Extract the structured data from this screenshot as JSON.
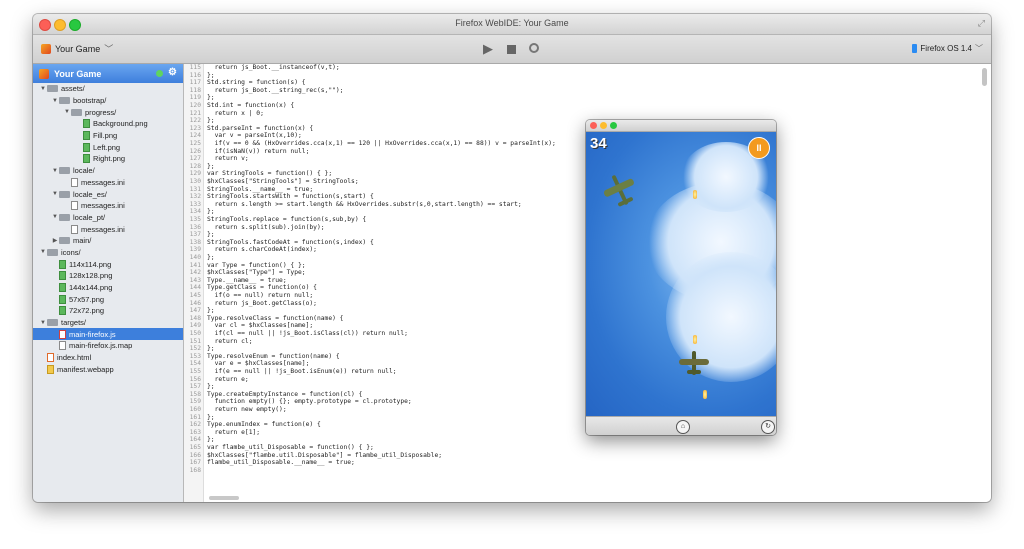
{
  "window": {
    "title": "Firefox WebIDE: Your Game"
  },
  "toolbar": {
    "project_label": "Your Game",
    "runtime_label": "Firefox OS 1.4",
    "play_icon": "play-icon",
    "stop_icon": "stop-icon",
    "debug_icon": "debug-icon"
  },
  "sidebar": {
    "project_name": "Your Game",
    "tree": [
      {
        "label": "assets/",
        "type": "folder",
        "depth": 0,
        "open": true
      },
      {
        "label": "bootstrap/",
        "type": "folder",
        "depth": 1,
        "open": true
      },
      {
        "label": "progress/",
        "type": "folder",
        "depth": 2,
        "open": true
      },
      {
        "label": "Background.png",
        "type": "img",
        "depth": 3
      },
      {
        "label": "Fill.png",
        "type": "img",
        "depth": 3
      },
      {
        "label": "Left.png",
        "type": "img",
        "depth": 3
      },
      {
        "label": "Right.png",
        "type": "img",
        "depth": 3
      },
      {
        "label": "locale/",
        "type": "folder",
        "depth": 1,
        "open": true
      },
      {
        "label": "messages.ini",
        "type": "file",
        "depth": 2
      },
      {
        "label": "locale_es/",
        "type": "folder",
        "depth": 1,
        "open": true
      },
      {
        "label": "messages.ini",
        "type": "file",
        "depth": 2
      },
      {
        "label": "locale_pt/",
        "type": "folder",
        "depth": 1,
        "open": true
      },
      {
        "label": "messages.ini",
        "type": "file",
        "depth": 2
      },
      {
        "label": "main/",
        "type": "folder",
        "depth": 1,
        "open": false
      },
      {
        "label": "icons/",
        "type": "folder",
        "depth": 0,
        "open": true
      },
      {
        "label": "114x114.png",
        "type": "img",
        "depth": 1
      },
      {
        "label": "128x128.png",
        "type": "img",
        "depth": 1
      },
      {
        "label": "144x144.png",
        "type": "img",
        "depth": 1
      },
      {
        "label": "57x57.png",
        "type": "img",
        "depth": 1
      },
      {
        "label": "72x72.png",
        "type": "img",
        "depth": 1
      },
      {
        "label": "targets/",
        "type": "folder",
        "depth": 0,
        "open": true
      },
      {
        "label": "main-firefox.js",
        "type": "js",
        "depth": 1,
        "selected": true
      },
      {
        "label": "main-firefox.js.map",
        "type": "file",
        "depth": 1
      },
      {
        "label": "index.html",
        "type": "html",
        "depth": 0
      },
      {
        "label": "manifest.webapp",
        "type": "webapp",
        "depth": 0
      }
    ]
  },
  "editor": {
    "lines": [
      {
        "n": "115",
        "text": "  return js_Boot.__instanceof(v,t);"
      },
      {
        "n": "116",
        "text": "};"
      },
      {
        "n": "117",
        "text": "Std.string = function(s) {"
      },
      {
        "n": "118",
        "text": "  return js_Boot.__string_rec(s,\"\");"
      },
      {
        "n": "119",
        "text": "};"
      },
      {
        "n": "120",
        "text": "Std.int = function(x) {"
      },
      {
        "n": "121",
        "text": "  return x | 0;"
      },
      {
        "n": "122",
        "text": "};"
      },
      {
        "n": "123",
        "text": "Std.parseInt = function(x) {"
      },
      {
        "n": "124",
        "text": "  var v = parseInt(x,10);"
      },
      {
        "n": "125",
        "text": "  if(v == 0 && (HxOverrides.cca(x,1) == 120 || HxOverrides.cca(x,1) == 88)) v = parseInt(x);"
      },
      {
        "n": "126",
        "text": "  if(isNaN(v)) return null;"
      },
      {
        "n": "127",
        "text": "  return v;"
      },
      {
        "n": "128",
        "text": "};"
      },
      {
        "n": "129",
        "text": "var StringTools = function() { };"
      },
      {
        "n": "130",
        "text": "$hxClasses[\"StringTools\"] = StringTools;"
      },
      {
        "n": "131",
        "text": "StringTools.__name__ = true;"
      },
      {
        "n": "132",
        "text": "StringTools.startsWith = function(s,start) {"
      },
      {
        "n": "133",
        "text": "  return s.length >= start.length && HxOverrides.substr(s,0,start.length) == start;"
      },
      {
        "n": "134",
        "text": "};"
      },
      {
        "n": "135",
        "text": "StringTools.replace = function(s,sub,by) {"
      },
      {
        "n": "136",
        "text": "  return s.split(sub).join(by);"
      },
      {
        "n": "137",
        "text": "};"
      },
      {
        "n": "138",
        "text": "StringTools.fastCodeAt = function(s,index) {"
      },
      {
        "n": "139",
        "text": "  return s.charCodeAt(index);"
      },
      {
        "n": "140",
        "text": "};"
      },
      {
        "n": "141",
        "text": "var Type = function() { };"
      },
      {
        "n": "142",
        "text": "$hxClasses[\"Type\"] = Type;"
      },
      {
        "n": "143",
        "text": "Type.__name__ = true;"
      },
      {
        "n": "144",
        "text": "Type.getClass = function(o) {"
      },
      {
        "n": "145",
        "text": "  if(o == null) return null;"
      },
      {
        "n": "146",
        "text": "  return js_Boot.getClass(o);"
      },
      {
        "n": "147",
        "text": "};"
      },
      {
        "n": "148",
        "text": "Type.resolveClass = function(name) {"
      },
      {
        "n": "149",
        "text": "  var cl = $hxClasses[name];"
      },
      {
        "n": "150",
        "text": "  if(cl == null || !js_Boot.isClass(cl)) return null;"
      },
      {
        "n": "151",
        "text": "  return cl;"
      },
      {
        "n": "152",
        "text": "};"
      },
      {
        "n": "153",
        "text": "Type.resolveEnum = function(name) {"
      },
      {
        "n": "154",
        "text": "  var e = $hxClasses[name];"
      },
      {
        "n": "155",
        "text": "  if(e == null || !js_Boot.isEnum(e)) return null;"
      },
      {
        "n": "156",
        "text": "  return e;"
      },
      {
        "n": "157",
        "text": "};"
      },
      {
        "n": "158",
        "text": "Type.createEmptyInstance = function(cl) {"
      },
      {
        "n": "159",
        "text": "  function empty() {}; empty.prototype = cl.prototype;"
      },
      {
        "n": "160",
        "text": "  return new empty();"
      },
      {
        "n": "161",
        "text": "};"
      },
      {
        "n": "162",
        "text": "Type.enumIndex = function(e) {"
      },
      {
        "n": "163",
        "text": "  return e[1];"
      },
      {
        "n": "164",
        "text": "};"
      },
      {
        "n": "165",
        "text": "var flambe_util_Disposable = function() { };"
      },
      {
        "n": "166",
        "text": "$hxClasses[\"flambe.util.Disposable\"] = flambe_util_Disposable;"
      },
      {
        "n": "167",
        "text": "flambe_util_Disposable.__name__ = true;"
      },
      {
        "n": "168",
        "text": ""
      }
    ]
  },
  "simulator": {
    "score": "34",
    "pause_label": "II",
    "home_icon": "home-icon",
    "rotate_icon": "rotate-icon"
  }
}
